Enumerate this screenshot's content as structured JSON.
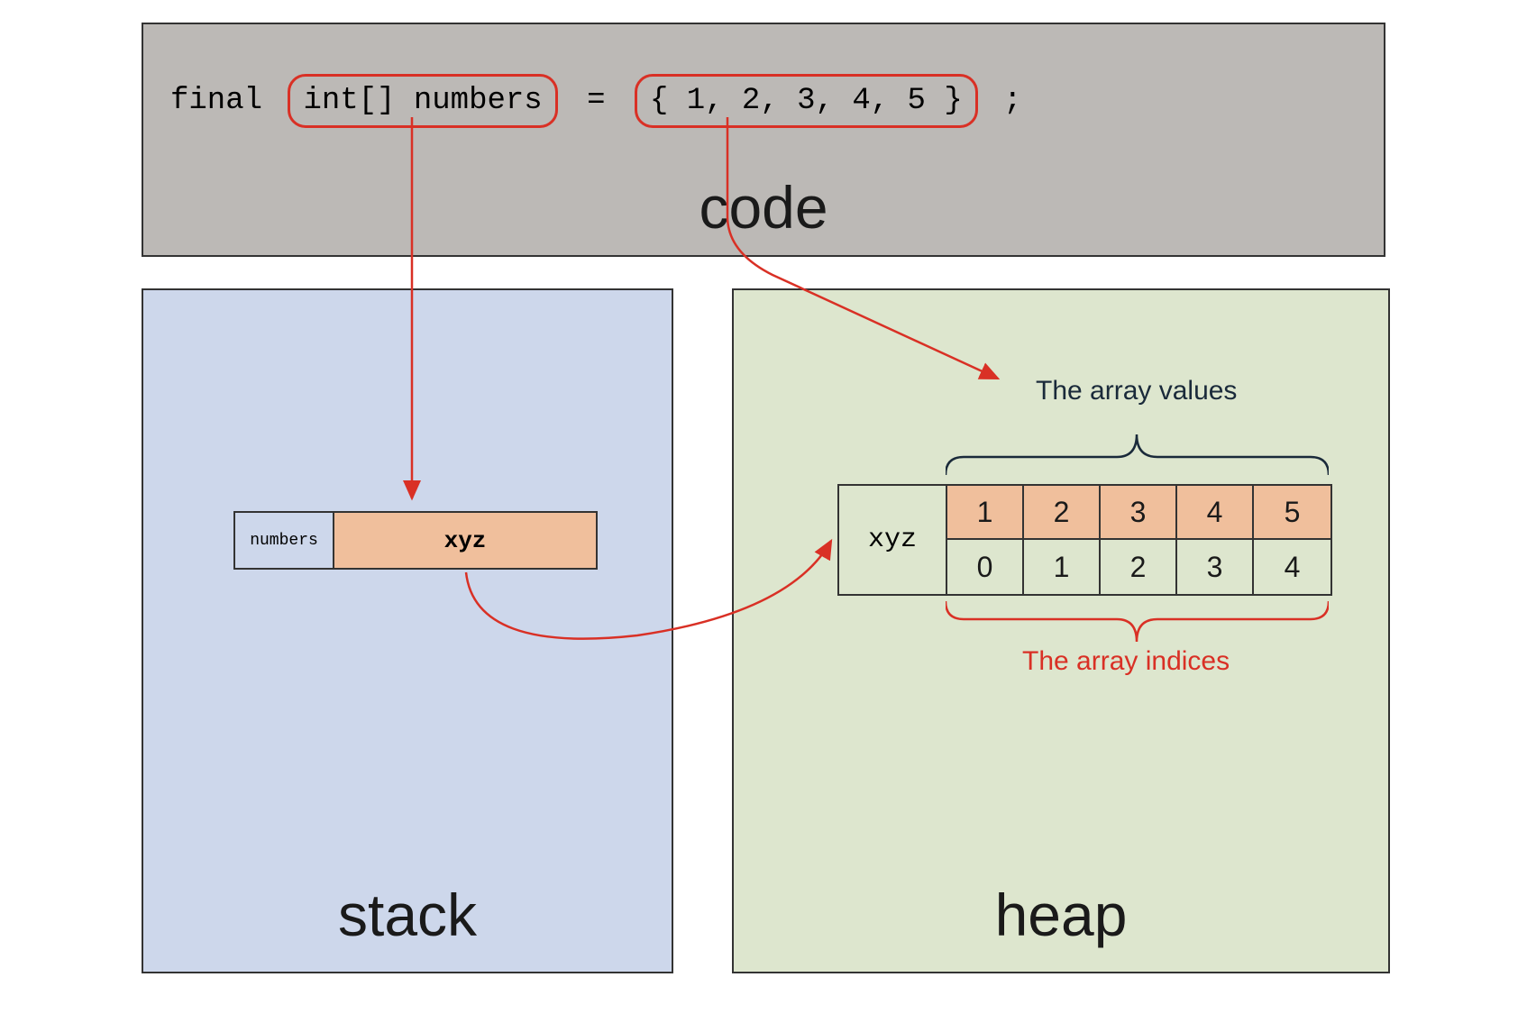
{
  "code": {
    "final_keyword": "final",
    "type_and_var": "int[] numbers",
    "equals": "=",
    "initializer": "{ 1, 2, 3, 4, 5 }",
    "semicolon": ";",
    "panel_label": "code"
  },
  "stack": {
    "panel_label": "stack",
    "var_name": "numbers",
    "var_value": "xyz"
  },
  "heap": {
    "panel_label": "heap",
    "ref_label": "xyz",
    "array_values_label": "The array values",
    "array_indices_label": "The array indices",
    "values": [
      "1",
      "2",
      "3",
      "4",
      "5"
    ],
    "indices": [
      "0",
      "1",
      "2",
      "3",
      "4"
    ]
  },
  "colors": {
    "red": "#d93025",
    "code_bg": "#bcb9b6",
    "stack_bg": "#cdd7eb",
    "heap_bg": "#dde6ce",
    "value_bg": "#f0bf9c"
  }
}
